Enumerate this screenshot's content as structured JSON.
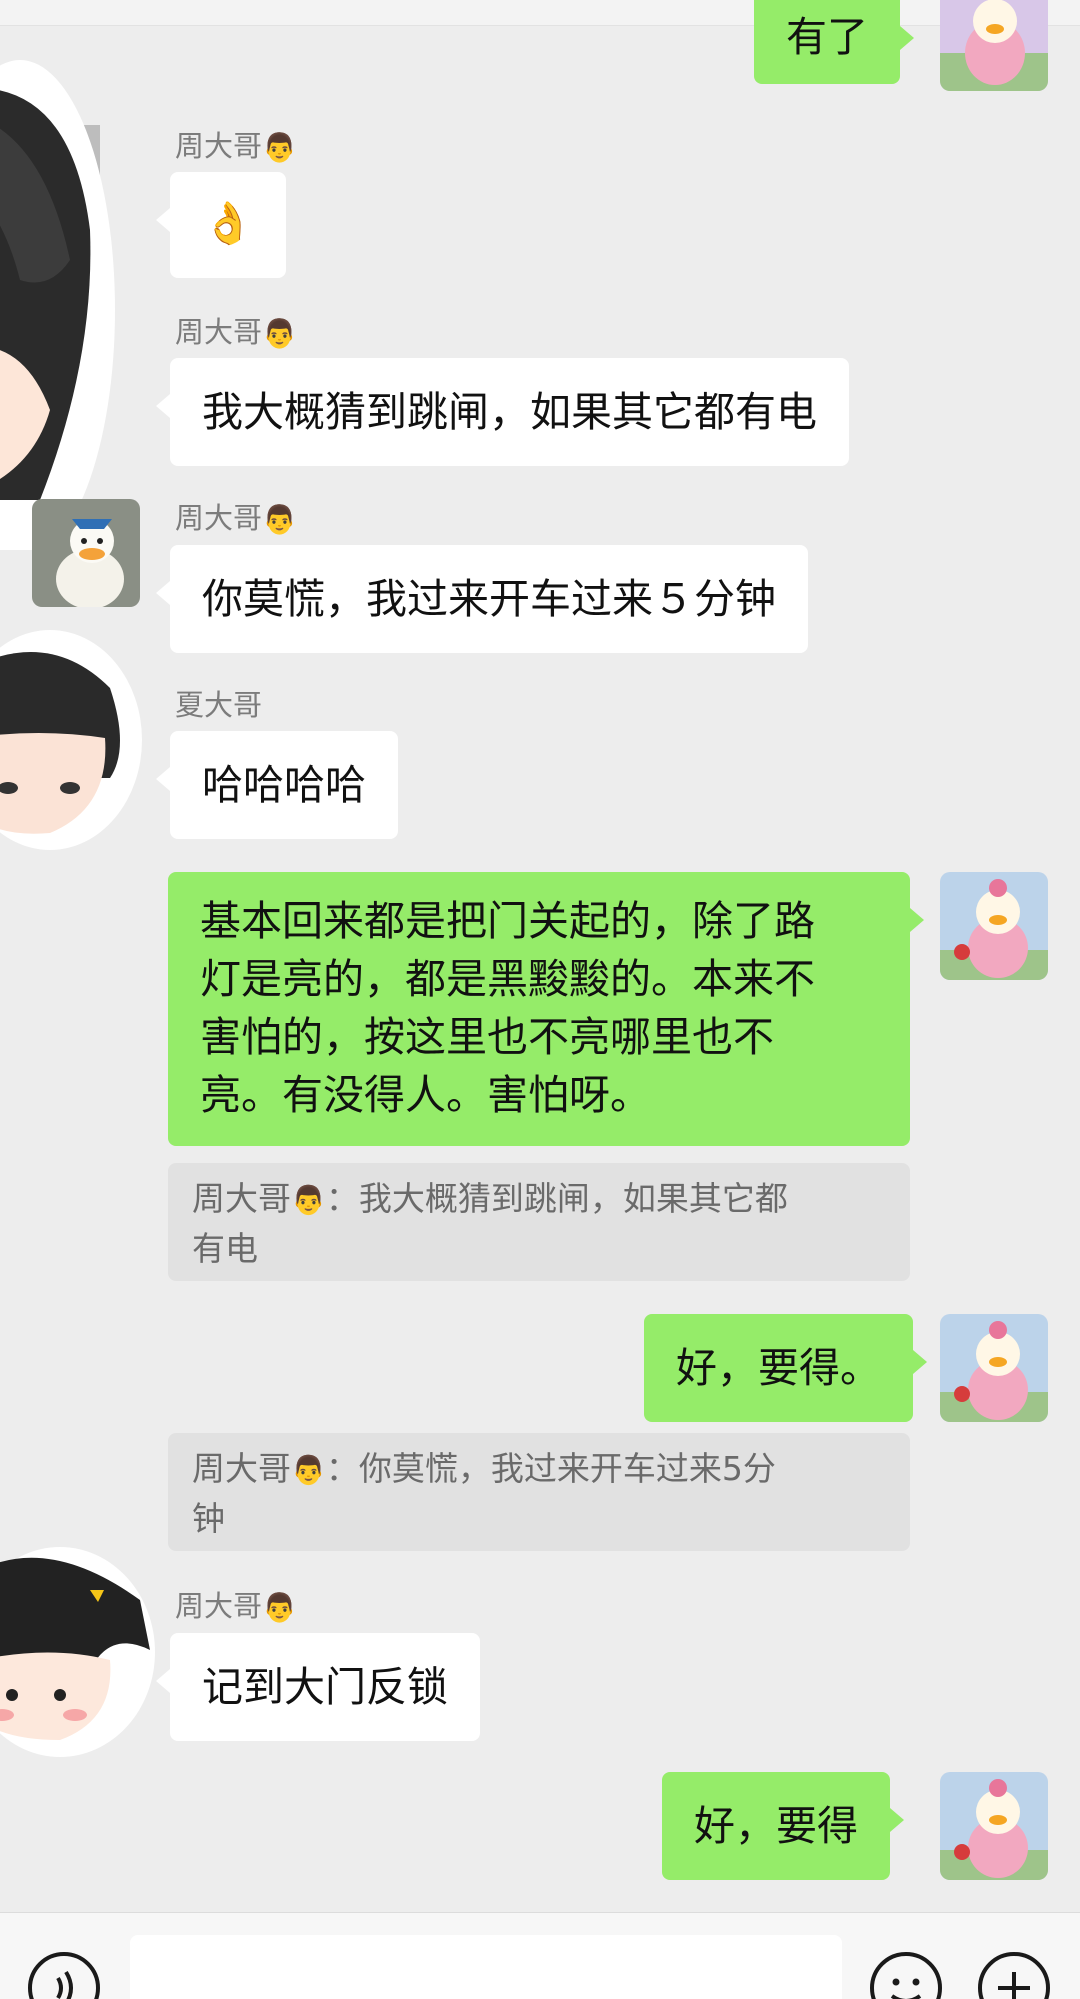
{
  "chat": {
    "messages": [
      {
        "side": "out",
        "text": "有了"
      },
      {
        "side": "in",
        "sender": "周大哥",
        "sender_emoji": "👨",
        "text": "👌"
      },
      {
        "side": "in",
        "sender": "周大哥",
        "sender_emoji": "👨",
        "text": "我大概猜到跳闸，如果其它都有电"
      },
      {
        "side": "in",
        "sender": "周大哥",
        "sender_emoji": "👨",
        "text": "你莫慌，我过来开车过来５分钟"
      },
      {
        "side": "in",
        "sender": "夏大哥",
        "text": "哈哈哈哈"
      },
      {
        "side": "out",
        "lines": [
          "基本回来都是把门关起的，除了路",
          "灯是亮的，都是黑黢黢的。本来不",
          "害怕的，按这里也不亮哪里也不",
          "亮。有没得人。害怕呀。"
        ],
        "quote": {
          "sender": "周大哥",
          "sender_emoji": "👨",
          "sep": "：",
          "lines": [
            "我大概猜到跳闸，如果其它都",
            "有电"
          ]
        }
      },
      {
        "side": "out",
        "text": "好，要得。",
        "quote": {
          "sender": "周大哥",
          "sender_emoji": "👨",
          "sep": "：",
          "lines": [
            "你莫慌，我过来开车过来5分",
            "钟"
          ]
        }
      },
      {
        "side": "in",
        "sender": "周大哥",
        "sender_emoji": "👨",
        "text": "记到大门反锁"
      },
      {
        "side": "out",
        "text": "好，要得"
      }
    ]
  },
  "icons": {
    "voice": "voice-icon",
    "emoji": "emoji-icon",
    "plus": "plus-icon"
  },
  "colors": {
    "background": "#ededed",
    "incoming_bubble": "#ffffff",
    "outgoing_bubble": "#95ec69",
    "quote_bg": "#e1e1e1"
  }
}
